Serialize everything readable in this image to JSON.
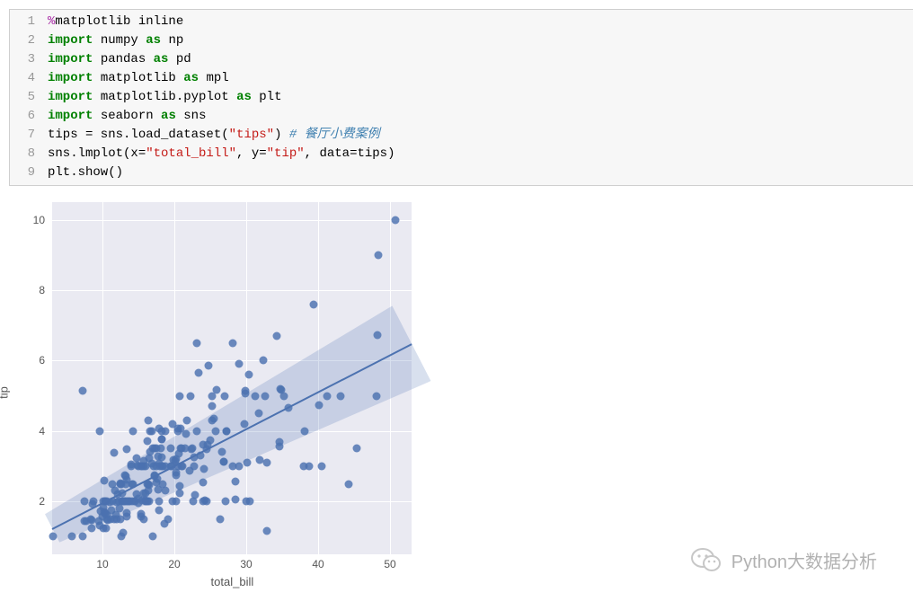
{
  "code": {
    "lines": [
      [
        {
          "t": "%",
          "c": "tok-mag"
        },
        {
          "t": "matplotlib inline",
          "c": "tok-id"
        }
      ],
      [
        {
          "t": "import",
          "c": "tok-kw"
        },
        {
          "t": " numpy ",
          "c": "tok-id"
        },
        {
          "t": "as",
          "c": "tok-kw"
        },
        {
          "t": " np",
          "c": "tok-alias"
        }
      ],
      [
        {
          "t": "import",
          "c": "tok-kw"
        },
        {
          "t": " pandas ",
          "c": "tok-id"
        },
        {
          "t": "as",
          "c": "tok-kw"
        },
        {
          "t": " pd",
          "c": "tok-alias"
        }
      ],
      [
        {
          "t": "import",
          "c": "tok-kw"
        },
        {
          "t": " matplotlib ",
          "c": "tok-id"
        },
        {
          "t": "as",
          "c": "tok-kw"
        },
        {
          "t": " mpl",
          "c": "tok-alias"
        }
      ],
      [
        {
          "t": "import",
          "c": "tok-kw"
        },
        {
          "t": " matplotlib.pyplot ",
          "c": "tok-id"
        },
        {
          "t": "as",
          "c": "tok-kw"
        },
        {
          "t": " plt",
          "c": "tok-alias"
        }
      ],
      [
        {
          "t": "import",
          "c": "tok-kw"
        },
        {
          "t": " seaborn ",
          "c": "tok-id"
        },
        {
          "t": "as",
          "c": "tok-kw"
        },
        {
          "t": " sns",
          "c": "tok-alias"
        }
      ],
      [
        {
          "t": "tips = sns.load_dataset(",
          "c": "tok-id"
        },
        {
          "t": "\"tips\"",
          "c": "tok-str"
        },
        {
          "t": ") ",
          "c": "tok-id"
        },
        {
          "t": "# 餐厅小费案例",
          "c": "tok-cmt"
        }
      ],
      [
        {
          "t": "sns.lmplot(x=",
          "c": "tok-id"
        },
        {
          "t": "\"total_bill\"",
          "c": "tok-str"
        },
        {
          "t": ", y=",
          "c": "tok-id"
        },
        {
          "t": "\"tip\"",
          "c": "tok-str"
        },
        {
          "t": ", data=tips)",
          "c": "tok-id"
        }
      ],
      [
        {
          "t": "plt.show()",
          "c": "tok-id"
        }
      ]
    ],
    "line_numbers": [
      "1",
      "2",
      "3",
      "4",
      "5",
      "6",
      "7",
      "8",
      "9"
    ]
  },
  "chart_data": {
    "type": "scatter",
    "title": "",
    "xlabel": "total_bill",
    "ylabel": "tip",
    "xlim": [
      3,
      53
    ],
    "ylim": [
      0.5,
      10.5
    ],
    "xticks": [
      10,
      20,
      30,
      40,
      50
    ],
    "yticks": [
      2,
      4,
      6,
      8,
      10
    ],
    "regression": {
      "slope": 0.105,
      "intercept": 0.92
    },
    "ci_band": {
      "x0": 3,
      "x1": 53,
      "y0_low": 0.8,
      "y0_high": 1.7,
      "y1_low": 5.3,
      "y1_high": 7.7
    },
    "points": [
      [
        16.99,
        1.01
      ],
      [
        10.34,
        1.66
      ],
      [
        21.01,
        3.5
      ],
      [
        23.68,
        3.31
      ],
      [
        24.59,
        3.61
      ],
      [
        25.29,
        4.71
      ],
      [
        8.77,
        2.0
      ],
      [
        26.88,
        3.12
      ],
      [
        15.04,
        1.96
      ],
      [
        14.78,
        3.23
      ],
      [
        10.27,
        1.71
      ],
      [
        35.26,
        5.0
      ],
      [
        15.42,
        1.57
      ],
      [
        18.43,
        3.0
      ],
      [
        14.83,
        3.02
      ],
      [
        21.58,
        3.92
      ],
      [
        10.33,
        1.67
      ],
      [
        16.29,
        3.71
      ],
      [
        16.97,
        3.5
      ],
      [
        20.65,
        3.35
      ],
      [
        17.92,
        4.08
      ],
      [
        20.29,
        2.75
      ],
      [
        15.77,
        2.23
      ],
      [
        39.42,
        7.58
      ],
      [
        19.82,
        3.18
      ],
      [
        17.81,
        2.34
      ],
      [
        13.37,
        2.0
      ],
      [
        12.69,
        2.0
      ],
      [
        21.7,
        4.3
      ],
      [
        19.65,
        3.0
      ],
      [
        9.55,
        1.45
      ],
      [
        18.35,
        2.5
      ],
      [
        15.06,
        3.0
      ],
      [
        20.69,
        2.45
      ],
      [
        17.78,
        3.27
      ],
      [
        24.06,
        3.6
      ],
      [
        16.31,
        2.0
      ],
      [
        16.93,
        3.07
      ],
      [
        18.69,
        2.31
      ],
      [
        31.27,
        5.0
      ],
      [
        16.04,
        2.24
      ],
      [
        17.46,
        2.54
      ],
      [
        13.94,
        3.06
      ],
      [
        9.68,
        1.32
      ],
      [
        30.4,
        5.6
      ],
      [
        18.29,
        3.0
      ],
      [
        22.23,
        5.0
      ],
      [
        32.4,
        6.0
      ],
      [
        28.55,
        2.05
      ],
      [
        18.04,
        3.0
      ],
      [
        12.54,
        2.5
      ],
      [
        10.29,
        2.6
      ],
      [
        34.81,
        5.2
      ],
      [
        9.94,
        1.56
      ],
      [
        25.56,
        4.34
      ],
      [
        19.49,
        3.51
      ],
      [
        38.01,
        3.0
      ],
      [
        26.41,
        1.5
      ],
      [
        11.24,
        1.76
      ],
      [
        48.27,
        6.73
      ],
      [
        20.29,
        3.21
      ],
      [
        13.81,
        2.0
      ],
      [
        11.02,
        1.98
      ],
      [
        18.29,
        3.76
      ],
      [
        17.59,
        2.64
      ],
      [
        20.08,
        3.15
      ],
      [
        16.45,
        2.47
      ],
      [
        3.07,
        1.0
      ],
      [
        20.23,
        2.01
      ],
      [
        15.01,
        2.09
      ],
      [
        12.02,
        1.97
      ],
      [
        17.07,
        3.0
      ],
      [
        26.86,
        3.14
      ],
      [
        25.28,
        5.0
      ],
      [
        14.73,
        2.2
      ],
      [
        10.51,
        1.25
      ],
      [
        17.92,
        3.08
      ],
      [
        27.2,
        4.0
      ],
      [
        22.76,
        3.0
      ],
      [
        17.29,
        2.71
      ],
      [
        19.44,
        3.0
      ],
      [
        16.66,
        3.4
      ],
      [
        10.07,
        1.83
      ],
      [
        32.68,
        5.0
      ],
      [
        15.98,
        2.03
      ],
      [
        34.83,
        5.17
      ],
      [
        13.03,
        2.0
      ],
      [
        18.28,
        4.0
      ],
      [
        24.71,
        5.85
      ],
      [
        21.16,
        3.0
      ],
      [
        28.97,
        3.0
      ],
      [
        22.49,
        3.5
      ],
      [
        5.75,
        1.0
      ],
      [
        16.32,
        4.3
      ],
      [
        22.75,
        3.25
      ],
      [
        40.17,
        4.73
      ],
      [
        27.28,
        4.0
      ],
      [
        12.03,
        1.5
      ],
      [
        21.01,
        3.0
      ],
      [
        12.46,
        1.5
      ],
      [
        11.35,
        2.5
      ],
      [
        15.38,
        3.0
      ],
      [
        44.3,
        2.5
      ],
      [
        22.42,
        3.48
      ],
      [
        20.92,
        4.08
      ],
      [
        15.36,
        1.64
      ],
      [
        20.49,
        4.06
      ],
      [
        25.21,
        4.29
      ],
      [
        18.24,
        3.76
      ],
      [
        14.31,
        4.0
      ],
      [
        14.0,
        3.0
      ],
      [
        7.25,
        1.0
      ],
      [
        38.07,
        4.0
      ],
      [
        23.95,
        2.55
      ],
      [
        25.71,
        4.0
      ],
      [
        17.31,
        3.5
      ],
      [
        29.93,
        5.07
      ],
      [
        10.65,
        1.5
      ],
      [
        12.43,
        1.8
      ],
      [
        24.08,
        2.92
      ],
      [
        11.69,
        2.31
      ],
      [
        13.42,
        1.68
      ],
      [
        14.26,
        2.5
      ],
      [
        15.95,
        2.0
      ],
      [
        12.48,
        2.52
      ],
      [
        29.8,
        4.2
      ],
      [
        8.52,
        1.48
      ],
      [
        14.52,
        2.0
      ],
      [
        11.38,
        2.0
      ],
      [
        22.82,
        2.18
      ],
      [
        19.08,
        1.5
      ],
      [
        20.27,
        2.83
      ],
      [
        11.17,
        1.5
      ],
      [
        12.26,
        2.0
      ],
      [
        18.26,
        3.25
      ],
      [
        8.51,
        1.25
      ],
      [
        10.33,
        2.0
      ],
      [
        14.15,
        2.0
      ],
      [
        16.0,
        2.0
      ],
      [
        13.16,
        2.75
      ],
      [
        17.47,
        3.5
      ],
      [
        34.3,
        6.7
      ],
      [
        41.19,
        5.0
      ],
      [
        27.05,
        5.0
      ],
      [
        16.43,
        2.3
      ],
      [
        8.35,
        1.5
      ],
      [
        18.64,
        1.36
      ],
      [
        11.87,
        1.63
      ],
      [
        9.78,
        1.73
      ],
      [
        7.51,
        2.0
      ],
      [
        14.07,
        2.5
      ],
      [
        13.13,
        2.0
      ],
      [
        17.26,
        2.74
      ],
      [
        24.55,
        2.0
      ],
      [
        19.77,
        2.0
      ],
      [
        29.85,
        5.14
      ],
      [
        48.17,
        5.0
      ],
      [
        25.0,
        3.75
      ],
      [
        13.39,
        2.61
      ],
      [
        16.49,
        2.0
      ],
      [
        21.5,
        3.5
      ],
      [
        12.66,
        2.5
      ],
      [
        16.21,
        2.0
      ],
      [
        13.81,
        2.0
      ],
      [
        17.51,
        3.0
      ],
      [
        24.52,
        3.48
      ],
      [
        20.76,
        2.24
      ],
      [
        31.71,
        4.5
      ],
      [
        10.59,
        1.61
      ],
      [
        10.63,
        2.0
      ],
      [
        50.81,
        10.0
      ],
      [
        15.81,
        3.16
      ],
      [
        7.25,
        5.15
      ],
      [
        31.85,
        3.18
      ],
      [
        16.82,
        4.0
      ],
      [
        32.9,
        3.11
      ],
      [
        17.89,
        2.0
      ],
      [
        14.48,
        2.0
      ],
      [
        9.6,
        4.0
      ],
      [
        34.63,
        3.55
      ],
      [
        34.65,
        3.68
      ],
      [
        23.33,
        5.65
      ],
      [
        45.35,
        3.5
      ],
      [
        23.17,
        6.5
      ],
      [
        40.55,
        3.0
      ],
      [
        20.69,
        5.0
      ],
      [
        20.9,
        3.5
      ],
      [
        30.46,
        2.0
      ],
      [
        18.15,
        3.5
      ],
      [
        23.1,
        4.0
      ],
      [
        15.69,
        1.5
      ],
      [
        19.81,
        4.19
      ],
      [
        28.44,
        2.56
      ],
      [
        15.48,
        2.02
      ],
      [
        16.58,
        4.0
      ],
      [
        7.56,
        1.44
      ],
      [
        10.34,
        2.0
      ],
      [
        43.11,
        5.0
      ],
      [
        13.0,
        2.0
      ],
      [
        13.51,
        2.0
      ],
      [
        18.71,
        4.0
      ],
      [
        12.74,
        2.01
      ],
      [
        13.0,
        2.0
      ],
      [
        16.4,
        2.5
      ],
      [
        20.53,
        4.0
      ],
      [
        16.47,
        3.23
      ],
      [
        26.59,
        3.41
      ],
      [
        38.73,
        3.0
      ],
      [
        24.27,
        2.03
      ],
      [
        12.76,
        2.23
      ],
      [
        30.06,
        2.0
      ],
      [
        25.89,
        5.16
      ],
      [
        48.33,
        9.0
      ],
      [
        13.27,
        2.5
      ],
      [
        28.17,
        6.5
      ],
      [
        12.9,
        1.1
      ],
      [
        28.15,
        3.0
      ],
      [
        11.59,
        1.5
      ],
      [
        7.74,
        1.44
      ],
      [
        30.14,
        3.09
      ],
      [
        12.16,
        2.2
      ],
      [
        13.42,
        3.48
      ],
      [
        8.58,
        1.92
      ],
      [
        15.98,
        3.0
      ],
      [
        13.42,
        1.58
      ],
      [
        16.27,
        2.5
      ],
      [
        10.09,
        2.0
      ],
      [
        20.45,
        3.0
      ],
      [
        13.28,
        2.72
      ],
      [
        22.12,
        2.88
      ],
      [
        24.01,
        2.0
      ],
      [
        15.69,
        3.0
      ],
      [
        11.61,
        3.39
      ],
      [
        10.77,
        1.47
      ],
      [
        15.53,
        3.0
      ],
      [
        10.07,
        1.25
      ],
      [
        12.6,
        1.0
      ],
      [
        32.83,
        1.17
      ],
      [
        35.83,
        4.67
      ],
      [
        29.03,
        5.92
      ],
      [
        27.18,
        2.0
      ],
      [
        22.67,
        2.0
      ],
      [
        17.82,
        1.75
      ],
      [
        18.78,
        3.0
      ]
    ]
  },
  "watermark": {
    "text": "Python大数据分析"
  }
}
